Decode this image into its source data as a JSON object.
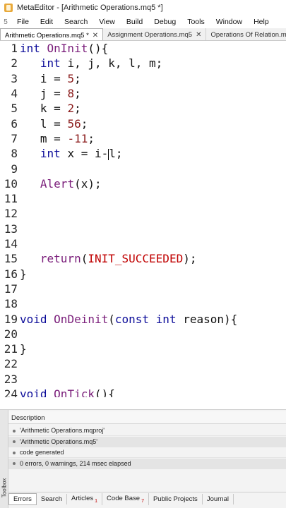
{
  "window": {
    "title": "MetaEditor - [Arithmetic Operations.mq5 *]"
  },
  "menu": {
    "gutter": "5",
    "items": [
      "File",
      "Edit",
      "Search",
      "View",
      "Build",
      "Debug",
      "Tools",
      "Window",
      "Help"
    ]
  },
  "tabs": [
    {
      "label": "Arithmetic Operations.mq5 *",
      "close": "✕",
      "active": true
    },
    {
      "label": "Assignment Operations.mq5",
      "close": "✕",
      "active": false
    },
    {
      "label": "Operations Of Relation.mq",
      "close": "",
      "active": false
    }
  ],
  "editor": {
    "lines": [
      {
        "n": "1",
        "tokens": [
          [
            "kw",
            "int "
          ],
          [
            "fn",
            "OnInit"
          ],
          [
            "",
            "(){"
          ]
        ]
      },
      {
        "n": "2",
        "tokens": [
          [
            "",
            "   "
          ],
          [
            "kw",
            "int "
          ],
          [
            "",
            "i, j, k, l, m;"
          ]
        ]
      },
      {
        "n": "3",
        "tokens": [
          [
            "",
            "   i = "
          ],
          [
            "num",
            "5"
          ],
          [
            "",
            ";"
          ]
        ]
      },
      {
        "n": "4",
        "tokens": [
          [
            "",
            "   j = "
          ],
          [
            "num",
            "8"
          ],
          [
            "",
            ";"
          ]
        ]
      },
      {
        "n": "5",
        "tokens": [
          [
            "",
            "   k = "
          ],
          [
            "num",
            "2"
          ],
          [
            "",
            ";"
          ]
        ]
      },
      {
        "n": "6",
        "tokens": [
          [
            "",
            "   l = "
          ],
          [
            "num",
            "56"
          ],
          [
            "",
            ";"
          ]
        ]
      },
      {
        "n": "7",
        "tokens": [
          [
            "",
            "   m = "
          ],
          [
            "num",
            "-11"
          ],
          [
            "",
            ";"
          ]
        ]
      },
      {
        "n": "8",
        "tokens": [
          [
            "",
            "   "
          ],
          [
            "kw",
            "int "
          ],
          [
            "",
            "x = i-"
          ],
          [
            "cursor",
            ""
          ],
          [
            "",
            "l;"
          ]
        ]
      },
      {
        "n": "9",
        "tokens": []
      },
      {
        "n": "10",
        "tokens": [
          [
            "",
            "   "
          ],
          [
            "fn",
            "Alert"
          ],
          [
            "",
            "(x);"
          ]
        ]
      },
      {
        "n": "11",
        "tokens": []
      },
      {
        "n": "12",
        "tokens": []
      },
      {
        "n": "13",
        "tokens": []
      },
      {
        "n": "14",
        "tokens": []
      },
      {
        "n": "15",
        "tokens": [
          [
            "",
            "   "
          ],
          [
            "fn",
            "return"
          ],
          [
            "",
            "("
          ],
          [
            "err",
            "INIT_SUCCEEDED"
          ],
          [
            "",
            ");"
          ]
        ]
      },
      {
        "n": "16",
        "tokens": [
          [
            "",
            "}"
          ]
        ]
      },
      {
        "n": "17",
        "tokens": []
      },
      {
        "n": "18",
        "tokens": []
      },
      {
        "n": "19",
        "tokens": [
          [
            "kw",
            "void "
          ],
          [
            "fn",
            "OnDeinit"
          ],
          [
            "",
            "("
          ],
          [
            "kw",
            "const int "
          ],
          [
            "",
            "reason){"
          ]
        ]
      },
      {
        "n": "20",
        "tokens": []
      },
      {
        "n": "21",
        "tokens": [
          [
            "",
            "}"
          ]
        ]
      },
      {
        "n": "22",
        "tokens": []
      },
      {
        "n": "23",
        "tokens": []
      },
      {
        "n": "24",
        "tokens": [
          [
            "kw",
            "void "
          ],
          [
            "fn",
            "OnTick"
          ],
          [
            "",
            "(){"
          ]
        ]
      }
    ]
  },
  "toolbox": {
    "side_label": "Toolbox",
    "header": "Description",
    "messages": [
      {
        "text": "'Arithmetic Operations.mqproj'",
        "selected": false
      },
      {
        "text": "'Arithmetic Operations.mq5'",
        "selected": true
      },
      {
        "text": "code generated",
        "selected": false
      },
      {
        "text": "0 errors, 0 warnings, 214 msec elapsed",
        "selected": true
      }
    ],
    "tabs": [
      {
        "label": "Errors",
        "badge": "",
        "active": true
      },
      {
        "label": "Search",
        "badge": "",
        "active": false
      },
      {
        "label": "Articles",
        "badge": "1",
        "active": false
      },
      {
        "label": "Code Base",
        "badge": "7",
        "active": false
      },
      {
        "label": "Public Projects",
        "badge": "",
        "active": false
      },
      {
        "label": "Journal",
        "badge": "",
        "active": false
      }
    ]
  }
}
